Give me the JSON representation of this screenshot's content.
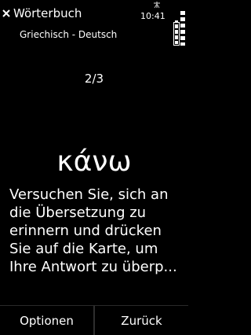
{
  "header": {
    "title": "Wörterbuch",
    "subtitle": "Griechisch - Deutsch",
    "close_icon": "close-icon"
  },
  "status_bar": {
    "time": "10:41",
    "icons": [
      "network-icon",
      "signal-icon",
      "battery-icon"
    ]
  },
  "card": {
    "progress": "2/3",
    "word": "κάνω",
    "hint": "Versuchen Sie, sich an die Übersetzung zu erinnern und drücken Sie auf die Karte, um Ihre Antwort zu überp..."
  },
  "softkeys": {
    "left": "Optionen",
    "right": "Zurück"
  }
}
